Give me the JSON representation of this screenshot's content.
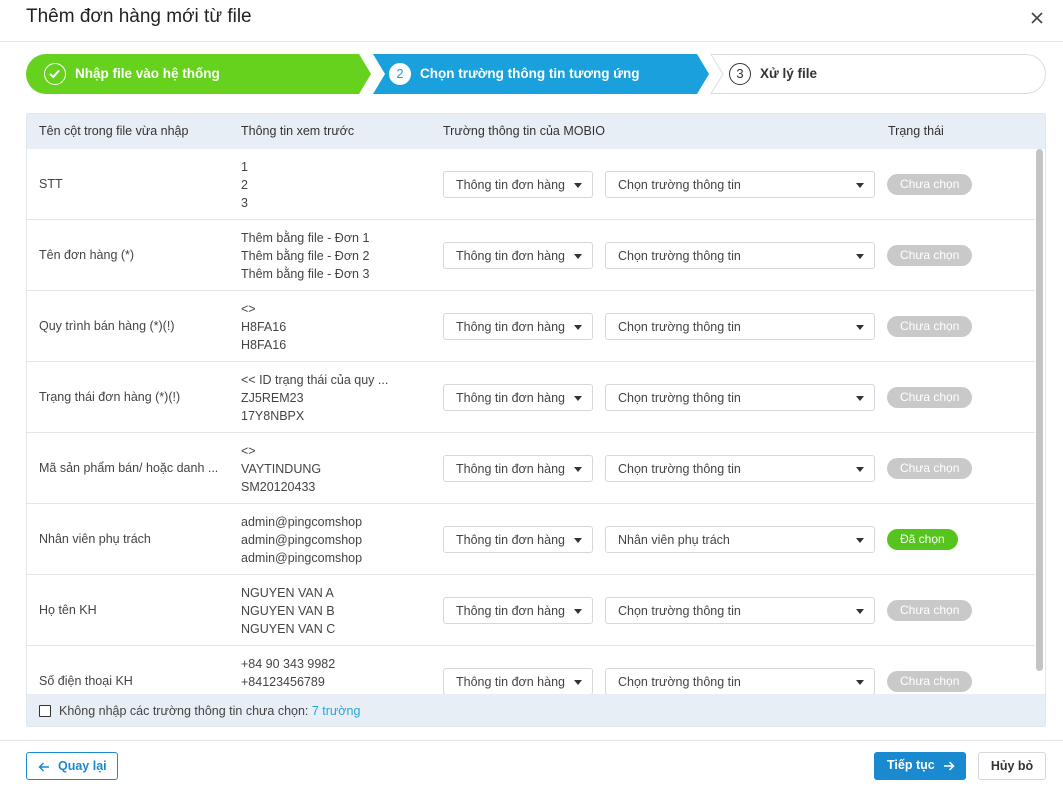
{
  "dialog": {
    "title": "Thêm đơn hàng mới từ file"
  },
  "steps": [
    {
      "label": "Nhập file vào hệ thống",
      "status": "done",
      "color": "#66d21e"
    },
    {
      "number": "2",
      "label": "Chọn trường thông tin tương ứng",
      "status": "active",
      "color": "#1aa0dc"
    },
    {
      "number": "3",
      "label": "Xử lý file",
      "status": "pending"
    }
  ],
  "table": {
    "headers": [
      "Tên cột trong file vừa nhập",
      "Thông tin xem trước",
      "Trường thông tin của MOBIO",
      "Trạng thái"
    ],
    "rows": [
      {
        "name": "STT",
        "preview": [
          "1",
          "2",
          "3"
        ],
        "group": "Thông tin đơn hàng",
        "field": "Chọn trường thông tin",
        "status": "Chưa chọn"
      },
      {
        "name": "Tên đơn hàng (*)",
        "preview": [
          "Thêm bằng file - Đơn 1",
          "Thêm bằng file - Đơn 2",
          "Thêm bằng file - Đơn 3"
        ],
        "group": "Thông tin đơn hàng",
        "field": "Chọn trường thông tin",
        "status": "Chưa chọn"
      },
      {
        "name": "Quy trình bán hàng (*)(!)",
        "preview": [
          "<>",
          "H8FA16",
          "H8FA16"
        ],
        "group": "Thông tin đơn hàng",
        "field": "Chọn trường thông tin",
        "status": "Chưa chọn"
      },
      {
        "name": "Trạng thái đơn hàng (*)(!)",
        "preview": [
          "<< ID trạng thái của quy ...",
          "ZJ5REM23",
          "17Y8NBPX"
        ],
        "group": "Thông tin đơn hàng",
        "field": "Chọn trường thông tin",
        "status": "Chưa chọn"
      },
      {
        "name": "Mã sản phẩm bán/ hoặc danh ...",
        "preview": [
          "<>",
          "VAYTINDUNG",
          "SM20120433"
        ],
        "group": "Thông tin đơn hàng",
        "field": "Chọn trường thông tin",
        "status": "Chưa chọn"
      },
      {
        "name": "Nhân viên phụ trách",
        "preview": [
          "admin@pingcomshop",
          "admin@pingcomshop",
          "admin@pingcomshop"
        ],
        "group": "Thông tin đơn hàng",
        "field": "Nhân viên phụ trách",
        "status": "Đã chọn"
      },
      {
        "name": "Họ tên KH",
        "preview": [
          "NGUYEN VAN A",
          "NGUYEN VAN B",
          "NGUYEN VAN C"
        ],
        "group": "Thông tin đơn hàng",
        "field": "Chọn trường thông tin",
        "status": "Chưa chọn"
      },
      {
        "name": "Số điện thoại KH",
        "preview": [
          "+84 90 343 9982",
          "+84123456789",
          ""
        ],
        "group": "Thông tin đơn hàng",
        "field": "Chọn trường thông tin",
        "status": "Chưa chọn"
      }
    ]
  },
  "footer_option": {
    "label": "Không nhập các trường thông tin chưa chọn: ",
    "count": "7 trường",
    "checked": false
  },
  "buttons": {
    "back": "Quay lại",
    "next": "Tiếp tục",
    "cancel": "Hủy bỏ"
  },
  "icons": [
    "check-icon",
    "close-icon",
    "arrow-left-icon",
    "arrow-right-icon",
    "caret-down-icon"
  ]
}
